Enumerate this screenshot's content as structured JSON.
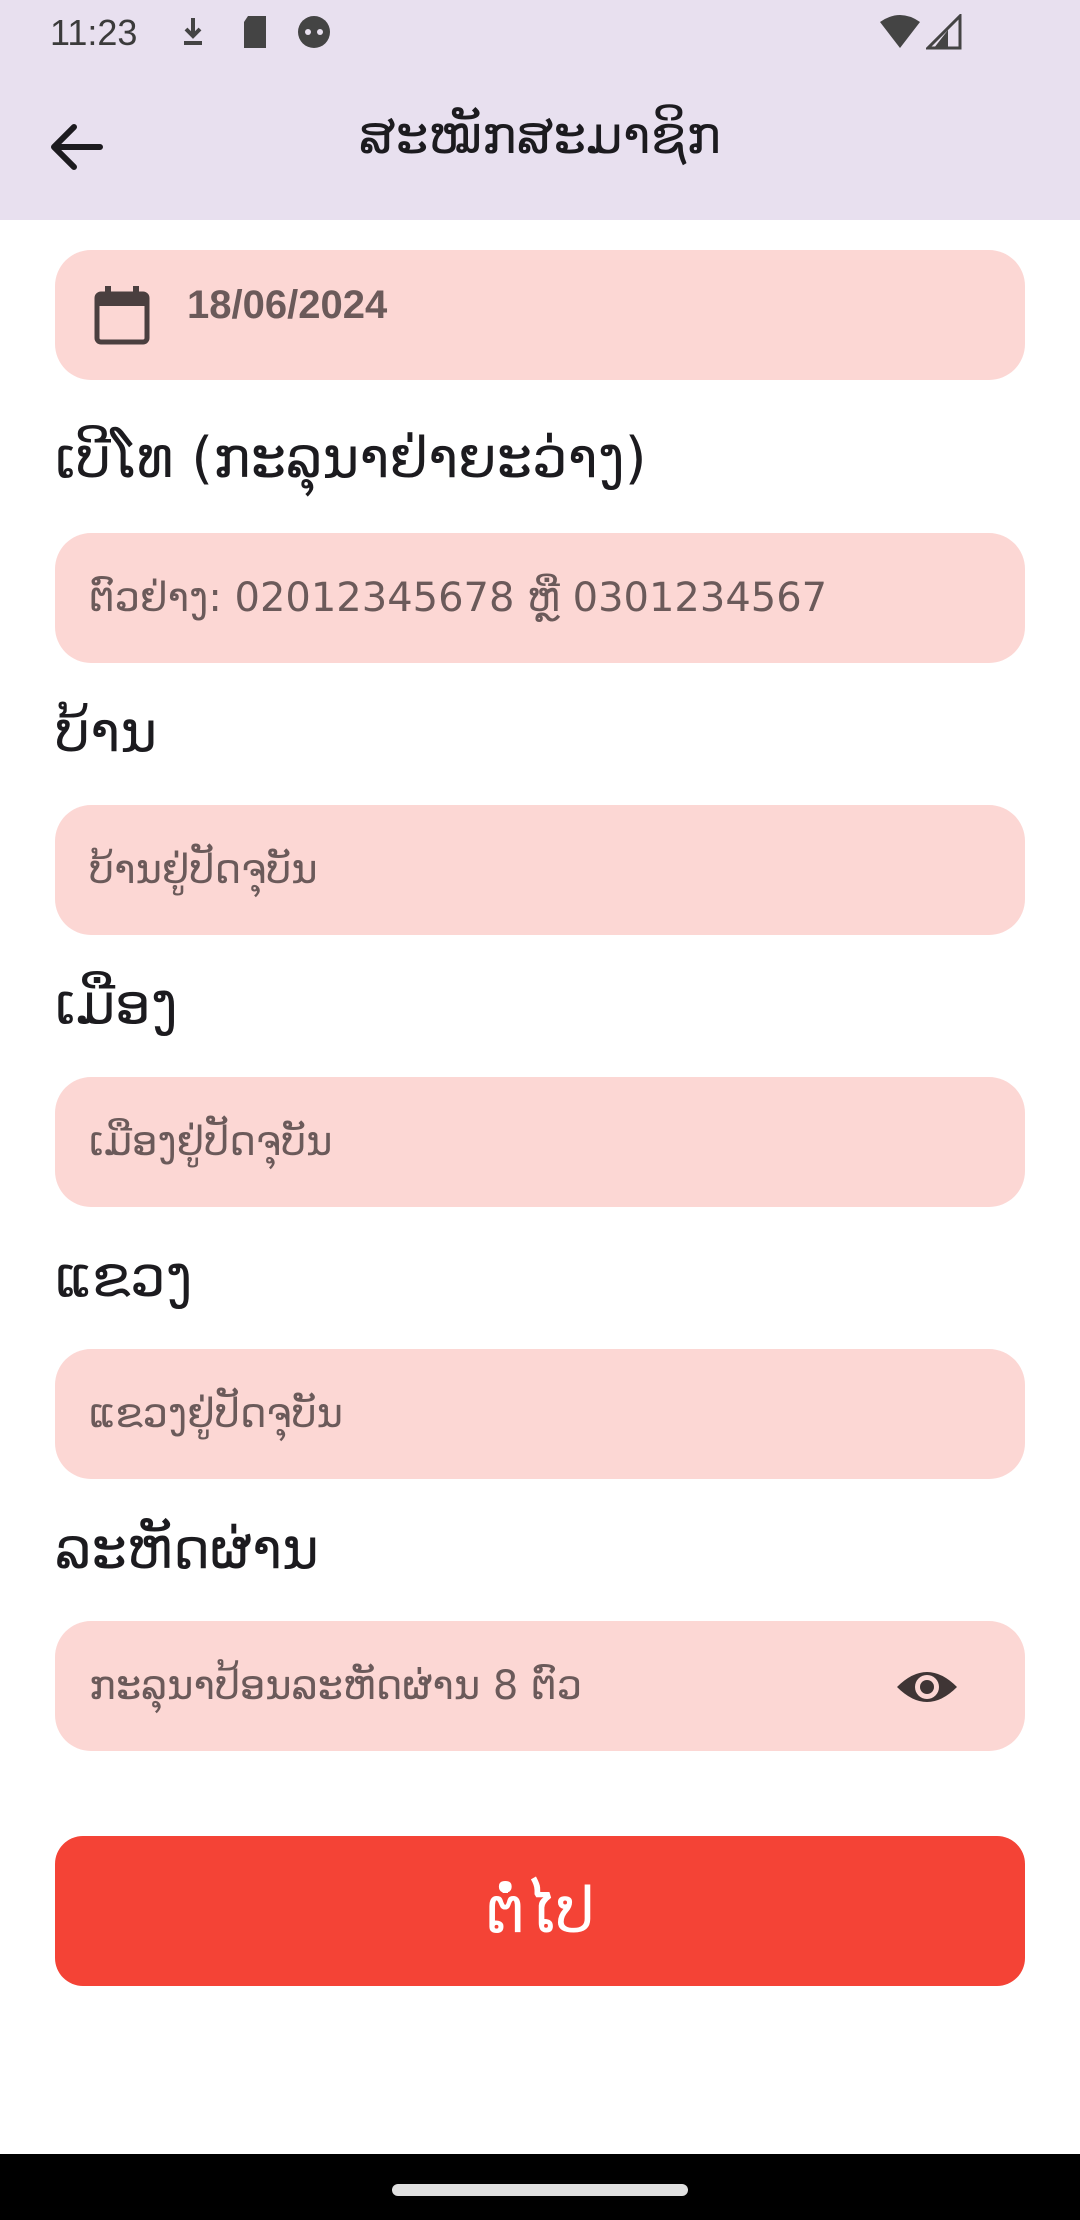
{
  "status_bar": {
    "time": "11:23",
    "icons": [
      "download-icon",
      "sd-card-icon",
      "android-icon",
      "wifi-icon",
      "signal-icon"
    ]
  },
  "app_bar": {
    "title": "ສະໝັກສະມາຊິກ",
    "back_icon": "arrow-left-icon"
  },
  "form": {
    "date_field": {
      "value": "18/06/2024",
      "icon": "calendar-icon"
    },
    "phone": {
      "label": "ເບີໂທ (ກະລຸນາຢ່າຍະວ່າງ)",
      "placeholder": "ຕົວຢ່າງ: 02012345678 ຫຼື 0301234567"
    },
    "village": {
      "label": "ບ້ານ",
      "placeholder": "ບ້ານຢູ່ປັດຈຸບັນ"
    },
    "district": {
      "label": "ເມືອງ",
      "placeholder": "ເມືອງຢູ່ປັດຈຸບັນ"
    },
    "province": {
      "label": "ແຂວງ",
      "placeholder": "ແຂວງຢູ່ປັດຈຸບັນ"
    },
    "password": {
      "label": "ລະຫັດຜ່ານ",
      "placeholder": "ກະລຸນາປ້ອນລະຫັດຜ່ານ 8 ຕົວ",
      "toggle_icon": "eye-icon"
    }
  },
  "next_button": {
    "label": "ຕໍ່ໄປ"
  },
  "colors": {
    "app_bar_bg": "#e8e0ef",
    "field_bg": "#fcd7d4",
    "button_bg": "#f44336"
  }
}
